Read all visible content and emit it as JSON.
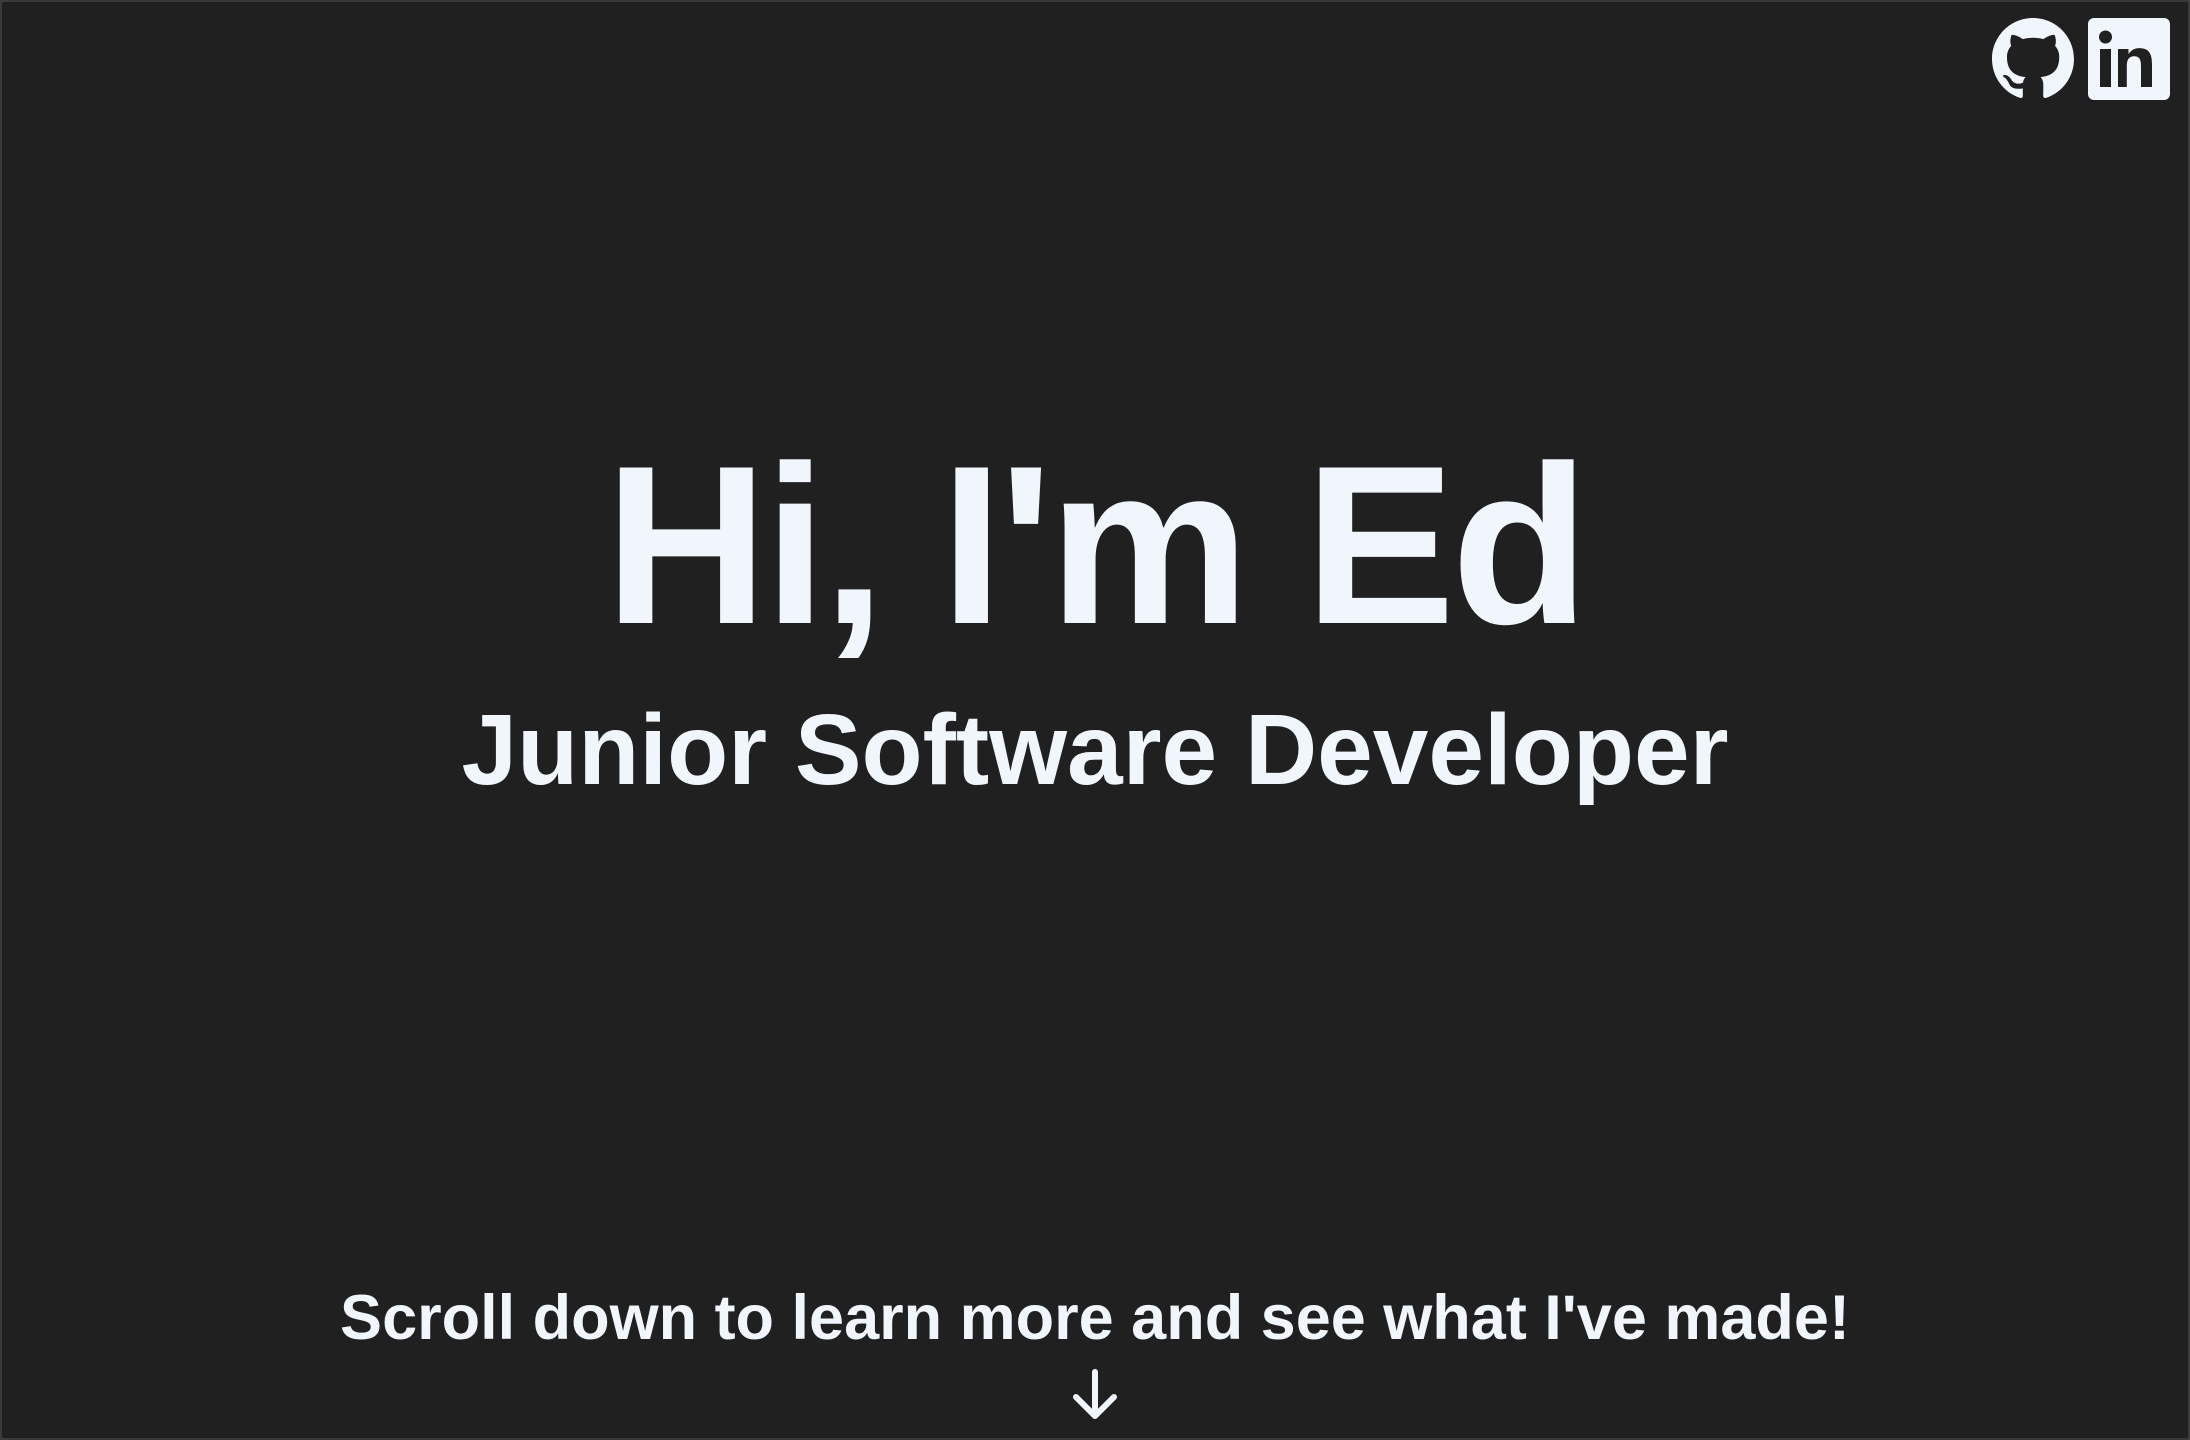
{
  "social": {
    "github_icon": "github-icon",
    "linkedin_icon": "linkedin-icon",
    "linkedin_text": "in"
  },
  "hero": {
    "title": "Hi, I'm Ed",
    "subtitle": "Junior Software Developer"
  },
  "cta": {
    "text": "Scroll down to learn more and see what I've made!",
    "arrow_icon": "arrow-down-icon"
  },
  "colors": {
    "background": "#202020",
    "text": "#f0f6fc"
  }
}
